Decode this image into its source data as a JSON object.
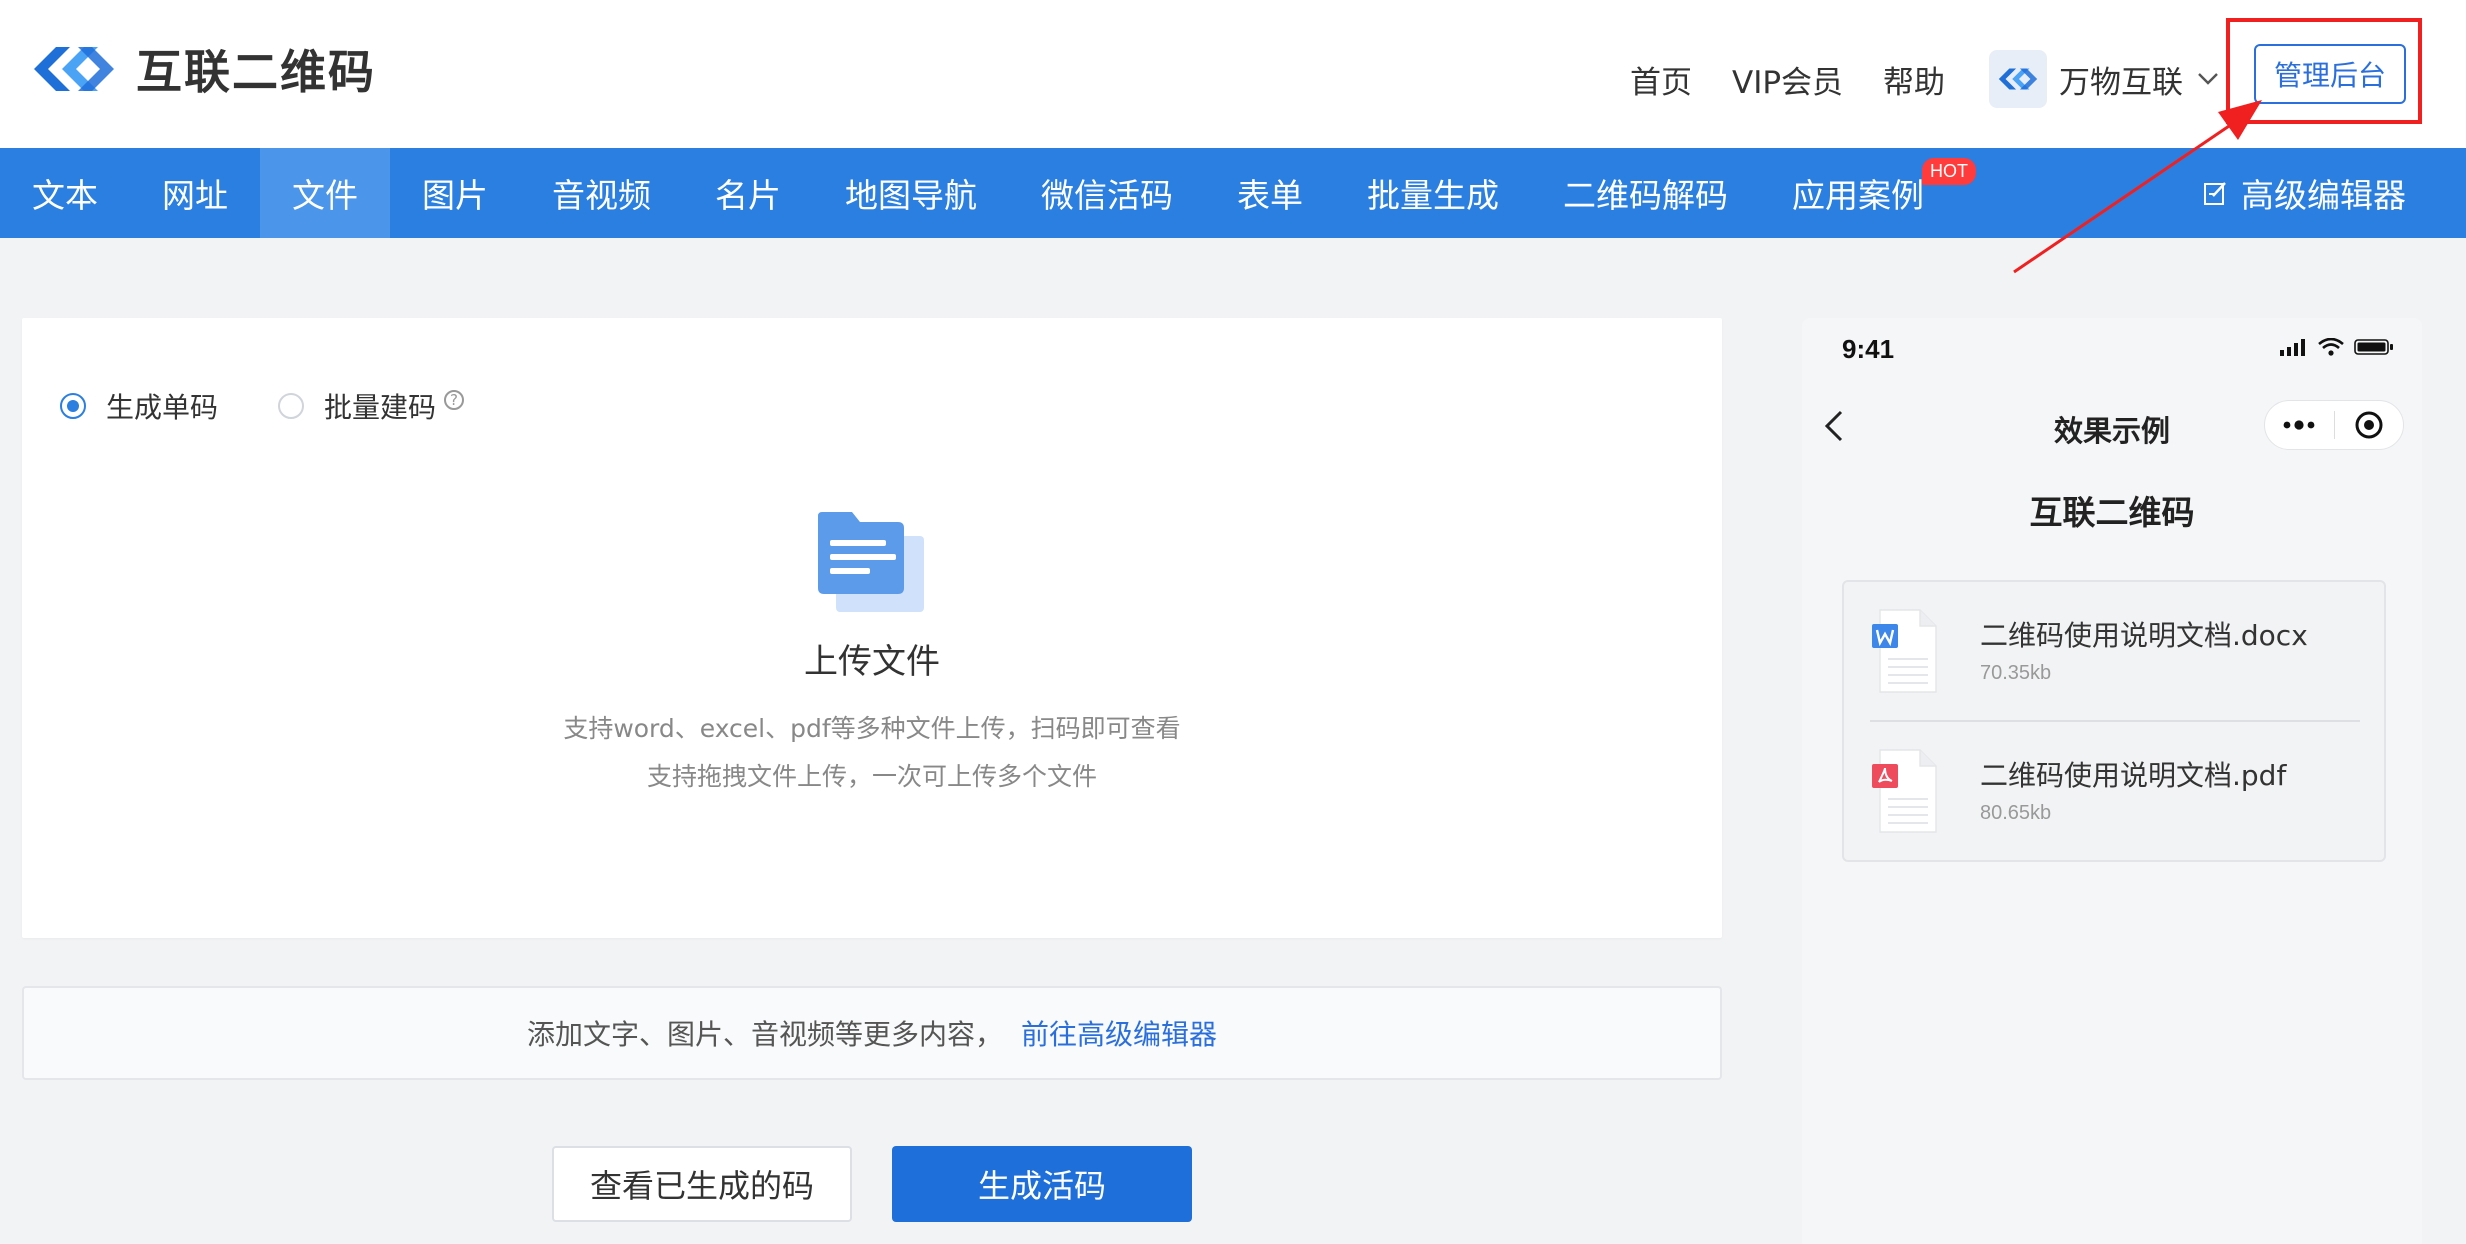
{
  "header": {
    "brand": "互联二维码",
    "links": [
      "首页",
      "VIP会员",
      "帮助"
    ],
    "org_name": "万物互联",
    "admin_label": "管理后台"
  },
  "mainnav": {
    "items": [
      "文本",
      "网址",
      "文件",
      "图片",
      "音视频",
      "名片",
      "地图导航",
      "微信活码",
      "表单",
      "批量生成",
      "二维码解码",
      "应用案例"
    ],
    "active_index": 2,
    "hot_badge": "HOT",
    "advanced_editor": "高级编辑器"
  },
  "upload_card": {
    "radio_single": "生成单码",
    "radio_batch": "批量建码",
    "selected": "生成单码",
    "upload_title": "上传文件",
    "desc_line1": "支持word、excel、pdf等多种文件上传，扫码即可查看",
    "desc_line2": "支持拖拽文件上传，一次可上传多个文件"
  },
  "hint_bar": {
    "text": "添加文字、图片、音视频等更多内容，",
    "link": "前往高级编辑器"
  },
  "buttons": {
    "view_generated": "查看已生成的码",
    "generate": "生成活码"
  },
  "phone": {
    "time": "9:41",
    "page_title": "效果示例",
    "subtitle": "互联二维码",
    "files": [
      {
        "name": "二维码使用说明文档.docx",
        "size": "70.35kb",
        "type": "word"
      },
      {
        "name": "二维码使用说明文档.pdf",
        "size": "80.65kb",
        "type": "pdf"
      }
    ]
  },
  "colors": {
    "nav_blue": "#2b7fe0",
    "nav_active": "#4b95ea",
    "primary_button": "#1e6fd9",
    "link": "#2b6fdc",
    "hot_badge": "#ff3b3b",
    "highlight_annotation": "#f02020"
  }
}
